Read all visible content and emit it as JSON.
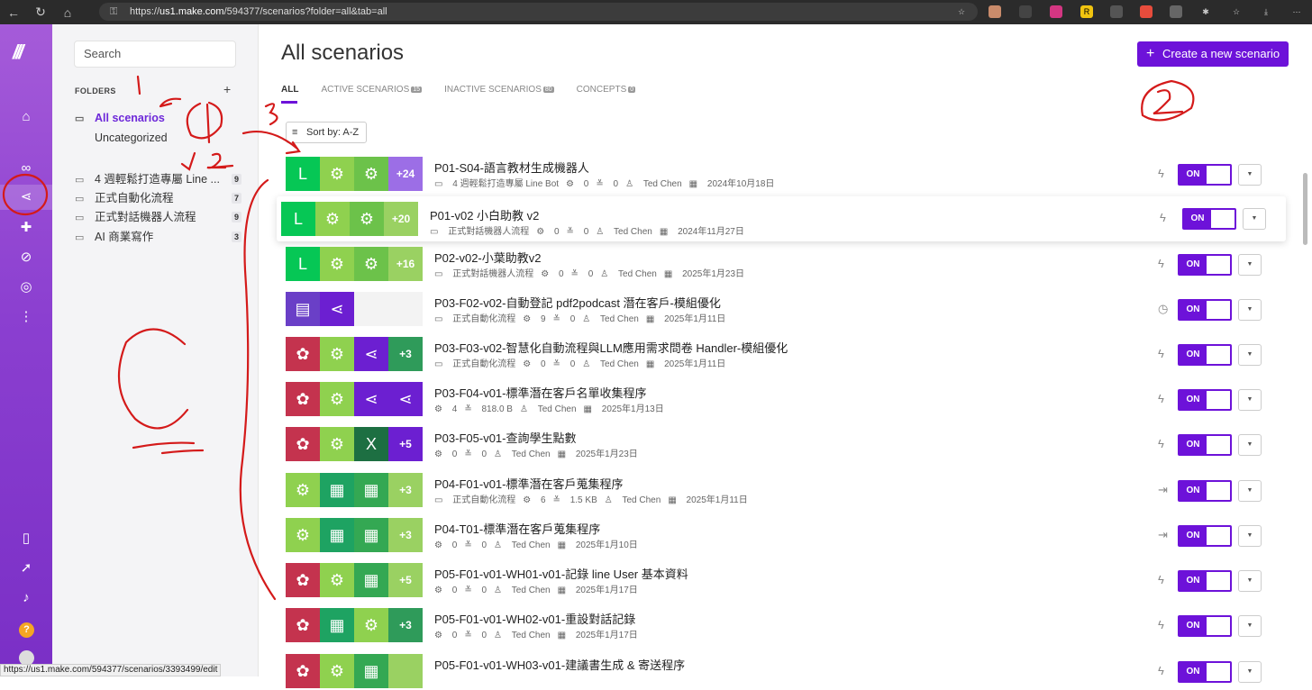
{
  "browser": {
    "url_scheme": "https://",
    "url_host": "us1.make.com",
    "url_path": "/594377/scenarios?folder=all&tab=all"
  },
  "status_url": "https://us1.make.com/594377/scenarios/3393499/edit",
  "sidebar": {
    "search_placeholder": "Search",
    "folders_label": "FOLDERS",
    "folders": [
      {
        "label": "All scenarios",
        "count": ""
      },
      {
        "label": "Uncategorized",
        "count": ""
      },
      {
        "label": "4 週輕鬆打造專屬 Line ...",
        "count": "9"
      },
      {
        "label": "正式自動化流程",
        "count": "7"
      },
      {
        "label": "正式對話機器人流程",
        "count": "9"
      },
      {
        "label": "AI 商業寫作",
        "count": "3"
      }
    ]
  },
  "header": {
    "title": "All scenarios",
    "create_label": "Create a new scenario",
    "tabs": [
      {
        "label": "ALL",
        "badge": ""
      },
      {
        "label": "ACTIVE SCENARIOS",
        "badge": "15"
      },
      {
        "label": "INACTIVE SCENARIOS",
        "badge": "80"
      },
      {
        "label": "CONCEPTS",
        "badge": "0"
      }
    ],
    "sort_label": "Sort by: A-Z"
  },
  "toggle_label": "ON",
  "scenarios": [
    {
      "title": "P01-S04-語言教材生成機器人",
      "folder": "4 週輕鬆打造專屬 Line Bot",
      "ops": "0",
      "data": "0",
      "owner": "Ted Chen",
      "date": "2024年10月18日",
      "more": "+24",
      "trigger": "instant"
    },
    {
      "title": "P01-v02 小白助教 v2",
      "folder": "正式對話機器人流程",
      "ops": "0",
      "data": "0",
      "owner": "Ted Chen",
      "date": "2024年11月27日",
      "more": "+20",
      "trigger": "instant"
    },
    {
      "title": "P02-v02-小葉助教v2",
      "folder": "正式對話機器人流程",
      "ops": "0",
      "data": "0",
      "owner": "Ted Chen",
      "date": "2025年1月23日",
      "more": "+16",
      "trigger": "instant"
    },
    {
      "title": "P03-F02-v02-自動登記 pdf2podcast 潛在客戶-模組優化",
      "folder": "正式自動化流程",
      "ops": "9",
      "data": "0",
      "owner": "Ted Chen",
      "date": "2025年1月11日",
      "more": "",
      "trigger": "scheduled"
    },
    {
      "title": "P03-F03-v02-智慧化自動流程與LLM應用需求問卷 Handler-模組優化",
      "folder": "正式自動化流程",
      "ops": "0",
      "data": "0",
      "owner": "Ted Chen",
      "date": "2025年1月11日",
      "more": "+3",
      "trigger": "instant"
    },
    {
      "title": "P03-F04-v01-標準潛在客戶名單收集程序",
      "folder": "",
      "ops": "4",
      "data": "818.0 B",
      "owner": "Ted Chen",
      "date": "2025年1月13日",
      "more": "",
      "trigger": "instant"
    },
    {
      "title": "P03-F05-v01-查詢學生點數",
      "folder": "",
      "ops": "0",
      "data": "0",
      "owner": "Ted Chen",
      "date": "2025年1月23日",
      "more": "+5",
      "trigger": "instant"
    },
    {
      "title": "P04-F01-v01-標準潛在客戶蒐集程序",
      "folder": "正式自動化流程",
      "ops": "6",
      "data": "1.5 KB",
      "owner": "Ted Chen",
      "date": "2025年1月11日",
      "more": "+3",
      "trigger": "on-demand"
    },
    {
      "title": "P04-T01-標準潛在客戶蒐集程序",
      "folder": "",
      "ops": "0",
      "data": "0",
      "owner": "Ted Chen",
      "date": "2025年1月10日",
      "more": "+3",
      "trigger": "on-demand"
    },
    {
      "title": "P05-F01-v01-WH01-v01-記錄 line User 基本資料",
      "folder": "",
      "ops": "0",
      "data": "0",
      "owner": "Ted Chen",
      "date": "2025年1月17日",
      "more": "+5",
      "trigger": "instant"
    },
    {
      "title": "P05-F01-v01-WH02-v01-重設對話記錄",
      "folder": "",
      "ops": "0",
      "data": "0",
      "owner": "Ted Chen",
      "date": "2025年1月17日",
      "more": "+3",
      "trigger": "instant"
    },
    {
      "title": "P05-F01-v01-WH03-v01-建議書生成 & 寄送程序",
      "folder": "",
      "ops": "",
      "data": "",
      "owner": "",
      "date": "",
      "more": "",
      "trigger": "instant"
    }
  ],
  "colors": {
    "brand": "#6d12d9",
    "rail": "#8b3fd0",
    "annotation": "#d41a1a"
  }
}
